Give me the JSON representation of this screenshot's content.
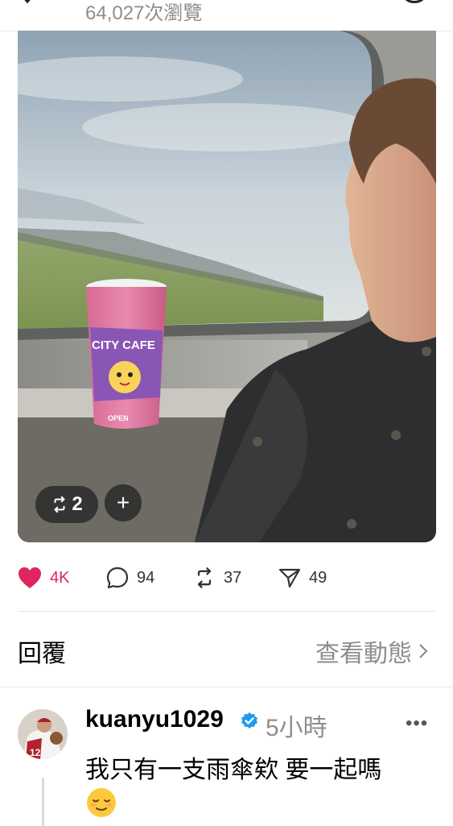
{
  "header": {
    "views_text": "64,027次瀏覽"
  },
  "photo": {
    "cup_brand_text": "CITY CAFE",
    "cup_sub_text": "OPEN",
    "repost_count": "2",
    "add_symbol": "+"
  },
  "actions": {
    "likes": "4K",
    "comments": "94",
    "reposts": "37",
    "shares": "49",
    "like_color": "#e0245e"
  },
  "replies": {
    "title": "回覆",
    "view_activity": "查看動態"
  },
  "comment": {
    "username": "kuanyu1029",
    "time": "5小時",
    "more": "•••",
    "text": "我只有一支雨傘欸 要一起嗎",
    "emoji": "relieved-face-emoji",
    "verified_color": "#1d9bf0"
  }
}
